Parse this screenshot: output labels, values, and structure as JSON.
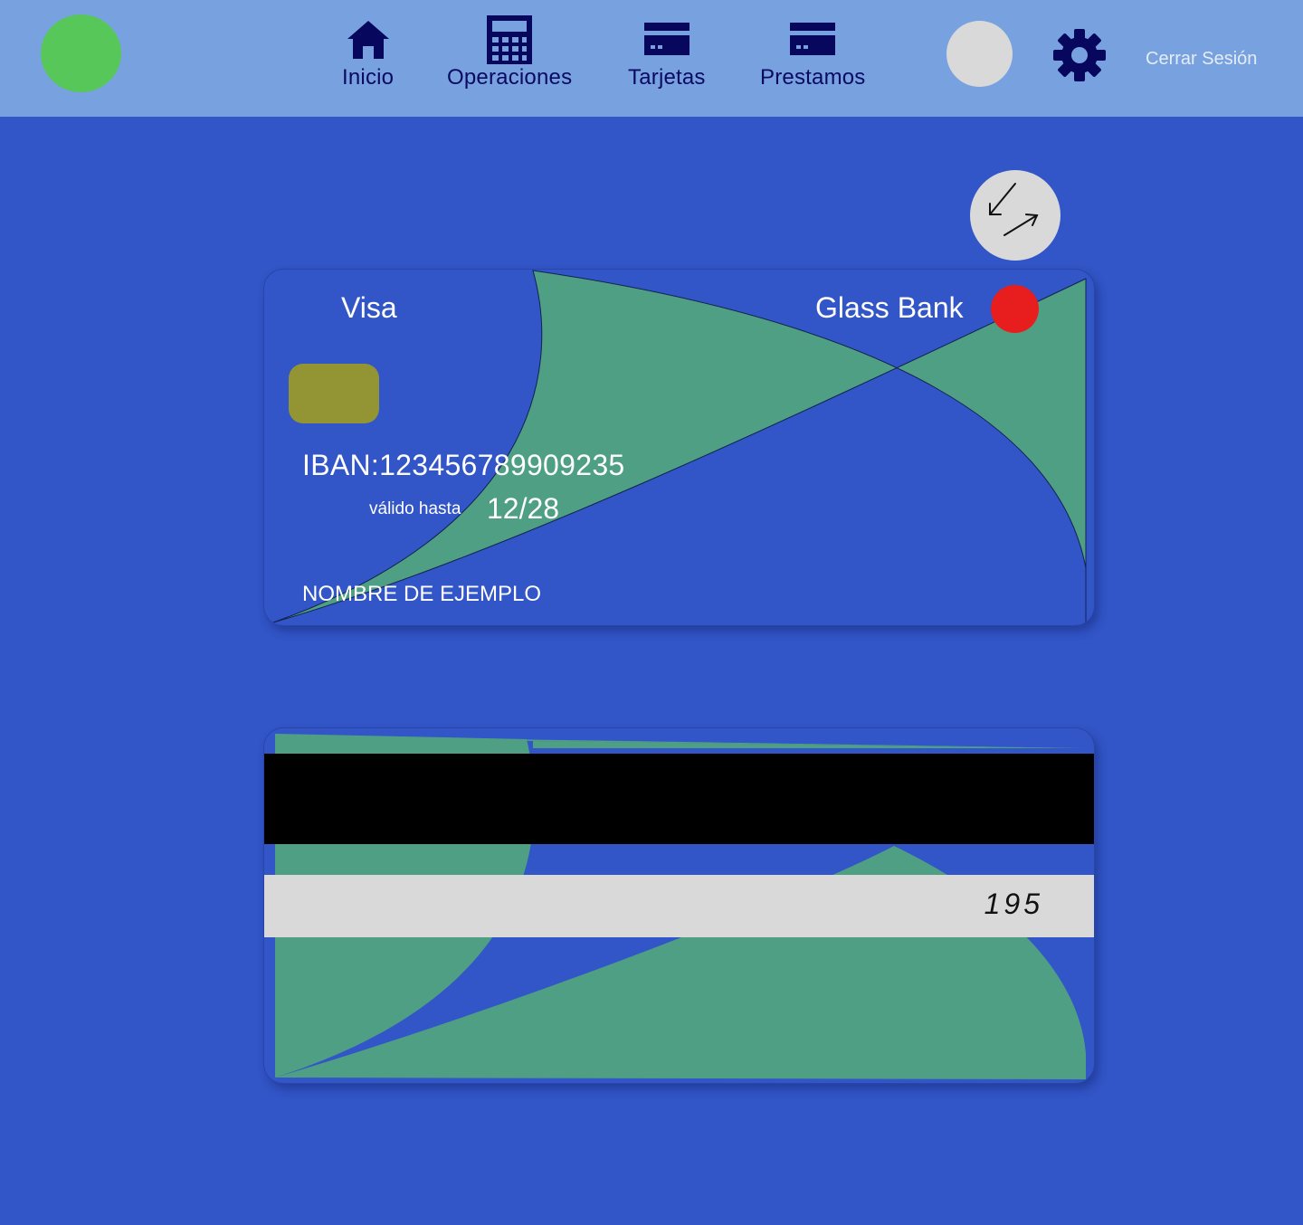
{
  "nav": {
    "items": [
      {
        "label": "Inicio",
        "icon": "home-icon"
      },
      {
        "label": "Operaciones",
        "icon": "calculator-icon"
      },
      {
        "label": "Tarjetas",
        "icon": "card-icon"
      },
      {
        "label": "Prestamos",
        "icon": "card-icon"
      }
    ],
    "logout_label": "Cerrar Sesión"
  },
  "card_front": {
    "brand": "Visa",
    "bank": "Glass Bank",
    "iban": "IBAN:123456789909235",
    "valid_label": "válido hasta",
    "valid_value": "12/28",
    "holder": "NOMBRE DE EJEMPLO"
  },
  "card_back": {
    "cvv": "195"
  },
  "colors": {
    "background": "#3255c7",
    "navbar": "#78a2df",
    "nav_text": "#0a0a62",
    "logo": "#57c75a",
    "card_wave": "#4f9f84",
    "chip": "#939433",
    "bank_dot": "#e81d1d",
    "avatar": "#d9d9d9"
  }
}
